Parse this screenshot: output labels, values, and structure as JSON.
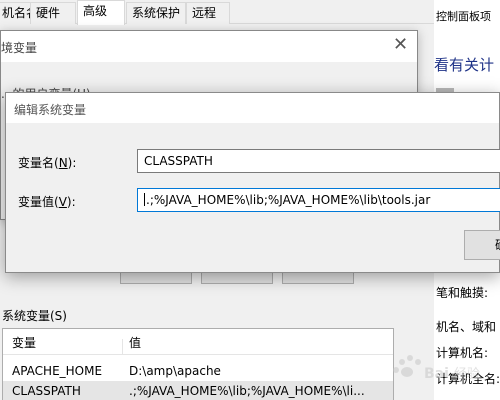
{
  "system_properties": {
    "tabs": [
      "机名名",
      "硬件",
      "高级",
      "系统保护",
      "远程"
    ],
    "active_tab": "高级",
    "system_vars_label": "系统变量(S)",
    "columns": [
      "变量",
      "值"
    ],
    "rows": [
      {
        "name": "APACHE_HOME",
        "value": "D:\\amp\\apache"
      },
      {
        "name": "CLASSPATH",
        "value": ".;%JAVA_HOME%\\lib;%JAVA_HOME%\\li..."
      }
    ]
  },
  "env_dialog": {
    "title": "境变量",
    "user_vars_label": "...的用户变量(U)"
  },
  "edit_dialog": {
    "title": "编辑系统变量",
    "name_label": "变量名(N):",
    "name_label_pre": "变量名(",
    "name_label_key": "N",
    "name_label_post": "):",
    "value_label_pre": "变量值(",
    "value_label_key": "V",
    "value_label_post": "):",
    "name_value": "CLASSPATH",
    "value_value": ".;%JAVA_HOME%\\lib;%JAVA_HOME%\\lib\\tools.jar",
    "ok_label": "确定"
  },
  "control_panel": {
    "crumb": "控制面板项",
    "heading": "看有关计",
    "lines": [
      "笔和触摸:",
      "机名、域和",
      "计算机名:",
      "计算机全名:"
    ]
  },
  "watermark": "Bai 经验"
}
